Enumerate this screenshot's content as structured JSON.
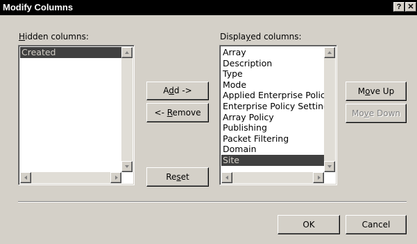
{
  "window": {
    "title": "Modify Columns",
    "help_glyph": "?",
    "close_glyph": "✕"
  },
  "hidden": {
    "label_mnemonic": "H",
    "label_rest": "idden columns:",
    "items": [
      "Created"
    ],
    "selected": "Created"
  },
  "displayed": {
    "label_pre": "Displa",
    "label_mnemonic": "y",
    "label_post": "ed columns:",
    "items": [
      "Array",
      "Description",
      "Type",
      "Mode",
      "Applied Enterprise Policy",
      "Enterprise Policy Settings",
      "Array Policy",
      "Publishing",
      "Packet Filtering",
      "Domain",
      "Site"
    ],
    "selected": "Site"
  },
  "buttons": {
    "add": {
      "pre": "A",
      "mnemonic": "d",
      "post": "d ->"
    },
    "remove": {
      "pre": "<- ",
      "mnemonic": "R",
      "post": "emove"
    },
    "reset": {
      "pre": "Re",
      "mnemonic": "s",
      "post": "et"
    },
    "move_up": {
      "pre": "M",
      "mnemonic": "o",
      "post": "ve Up"
    },
    "move_down": {
      "pre": "Mo",
      "mnemonic": "v",
      "post": "e Down"
    },
    "ok": "OK",
    "cancel": "Cancel"
  }
}
